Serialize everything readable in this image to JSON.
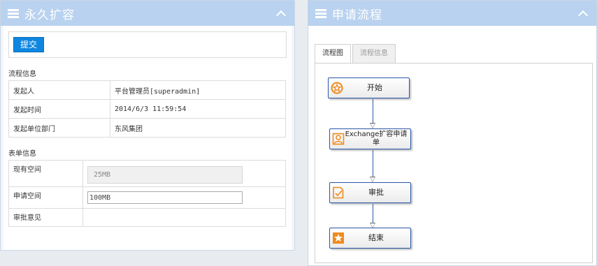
{
  "left_panel": {
    "title": "永久扩容",
    "submit_label": "提交",
    "process_section": {
      "label": "流程信息",
      "rows": [
        {
          "key": "发起人",
          "value": "平台管理员[superadmin]"
        },
        {
          "key": "发起时间",
          "value": "2014/6/3 11:59:54"
        },
        {
          "key": "发起单位部门",
          "value": "东风集团"
        }
      ]
    },
    "form_section": {
      "label": "表单信息",
      "current_space_label": "现有空间",
      "current_space_value": "25MB",
      "request_space_label": "申请空间",
      "request_space_value": "100MB",
      "approval_opinion_label": "审批意见"
    }
  },
  "right_panel": {
    "title": "申请流程",
    "tabs": [
      {
        "label": "流程图",
        "active": true
      },
      {
        "label": "流程信息",
        "active": false
      }
    ],
    "flow_nodes": [
      {
        "label": "开始",
        "icon": "star-circle-icon"
      },
      {
        "label": "Exchange扩容申请单",
        "icon": "user-form-icon"
      },
      {
        "label": "审批",
        "icon": "approve-document-icon"
      },
      {
        "label": "结束",
        "icon": "star-box-icon"
      }
    ]
  },
  "colors": {
    "header_bg": "#b9d2ef",
    "button_blue": "#0e86e0",
    "node_border": "#2a57a8",
    "icon_orange": "#f08a1c"
  }
}
